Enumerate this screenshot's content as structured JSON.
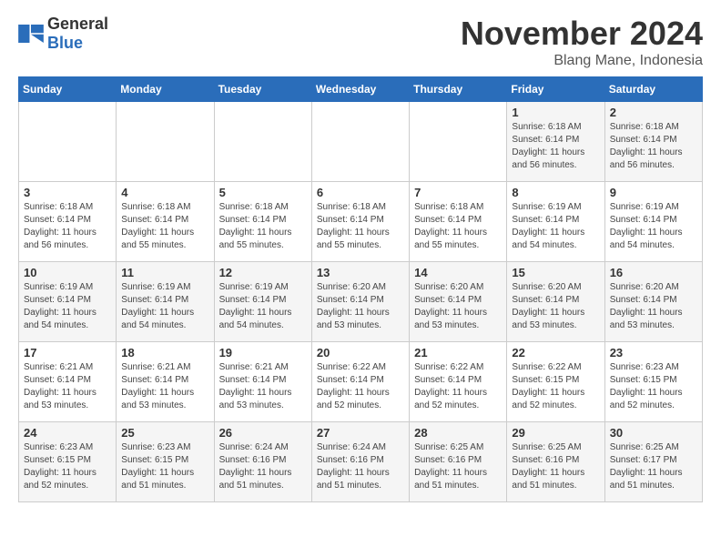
{
  "logo": {
    "text_general": "General",
    "text_blue": "Blue"
  },
  "title": "November 2024",
  "subtitle": "Blang Mane, Indonesia",
  "days_of_week": [
    "Sunday",
    "Monday",
    "Tuesday",
    "Wednesday",
    "Thursday",
    "Friday",
    "Saturday"
  ],
  "weeks": [
    [
      {
        "day": "",
        "info": ""
      },
      {
        "day": "",
        "info": ""
      },
      {
        "day": "",
        "info": ""
      },
      {
        "day": "",
        "info": ""
      },
      {
        "day": "",
        "info": ""
      },
      {
        "day": "1",
        "info": "Sunrise: 6:18 AM\nSunset: 6:14 PM\nDaylight: 11 hours\nand 56 minutes."
      },
      {
        "day": "2",
        "info": "Sunrise: 6:18 AM\nSunset: 6:14 PM\nDaylight: 11 hours\nand 56 minutes."
      }
    ],
    [
      {
        "day": "3",
        "info": "Sunrise: 6:18 AM\nSunset: 6:14 PM\nDaylight: 11 hours\nand 56 minutes."
      },
      {
        "day": "4",
        "info": "Sunrise: 6:18 AM\nSunset: 6:14 PM\nDaylight: 11 hours\nand 55 minutes."
      },
      {
        "day": "5",
        "info": "Sunrise: 6:18 AM\nSunset: 6:14 PM\nDaylight: 11 hours\nand 55 minutes."
      },
      {
        "day": "6",
        "info": "Sunrise: 6:18 AM\nSunset: 6:14 PM\nDaylight: 11 hours\nand 55 minutes."
      },
      {
        "day": "7",
        "info": "Sunrise: 6:18 AM\nSunset: 6:14 PM\nDaylight: 11 hours\nand 55 minutes."
      },
      {
        "day": "8",
        "info": "Sunrise: 6:19 AM\nSunset: 6:14 PM\nDaylight: 11 hours\nand 54 minutes."
      },
      {
        "day": "9",
        "info": "Sunrise: 6:19 AM\nSunset: 6:14 PM\nDaylight: 11 hours\nand 54 minutes."
      }
    ],
    [
      {
        "day": "10",
        "info": "Sunrise: 6:19 AM\nSunset: 6:14 PM\nDaylight: 11 hours\nand 54 minutes."
      },
      {
        "day": "11",
        "info": "Sunrise: 6:19 AM\nSunset: 6:14 PM\nDaylight: 11 hours\nand 54 minutes."
      },
      {
        "day": "12",
        "info": "Sunrise: 6:19 AM\nSunset: 6:14 PM\nDaylight: 11 hours\nand 54 minutes."
      },
      {
        "day": "13",
        "info": "Sunrise: 6:20 AM\nSunset: 6:14 PM\nDaylight: 11 hours\nand 53 minutes."
      },
      {
        "day": "14",
        "info": "Sunrise: 6:20 AM\nSunset: 6:14 PM\nDaylight: 11 hours\nand 53 minutes."
      },
      {
        "day": "15",
        "info": "Sunrise: 6:20 AM\nSunset: 6:14 PM\nDaylight: 11 hours\nand 53 minutes."
      },
      {
        "day": "16",
        "info": "Sunrise: 6:20 AM\nSunset: 6:14 PM\nDaylight: 11 hours\nand 53 minutes."
      }
    ],
    [
      {
        "day": "17",
        "info": "Sunrise: 6:21 AM\nSunset: 6:14 PM\nDaylight: 11 hours\nand 53 minutes."
      },
      {
        "day": "18",
        "info": "Sunrise: 6:21 AM\nSunset: 6:14 PM\nDaylight: 11 hours\nand 53 minutes."
      },
      {
        "day": "19",
        "info": "Sunrise: 6:21 AM\nSunset: 6:14 PM\nDaylight: 11 hours\nand 53 minutes."
      },
      {
        "day": "20",
        "info": "Sunrise: 6:22 AM\nSunset: 6:14 PM\nDaylight: 11 hours\nand 52 minutes."
      },
      {
        "day": "21",
        "info": "Sunrise: 6:22 AM\nSunset: 6:14 PM\nDaylight: 11 hours\nand 52 minutes."
      },
      {
        "day": "22",
        "info": "Sunrise: 6:22 AM\nSunset: 6:15 PM\nDaylight: 11 hours\nand 52 minutes."
      },
      {
        "day": "23",
        "info": "Sunrise: 6:23 AM\nSunset: 6:15 PM\nDaylight: 11 hours\nand 52 minutes."
      }
    ],
    [
      {
        "day": "24",
        "info": "Sunrise: 6:23 AM\nSunset: 6:15 PM\nDaylight: 11 hours\nand 52 minutes."
      },
      {
        "day": "25",
        "info": "Sunrise: 6:23 AM\nSunset: 6:15 PM\nDaylight: 11 hours\nand 51 minutes."
      },
      {
        "day": "26",
        "info": "Sunrise: 6:24 AM\nSunset: 6:16 PM\nDaylight: 11 hours\nand 51 minutes."
      },
      {
        "day": "27",
        "info": "Sunrise: 6:24 AM\nSunset: 6:16 PM\nDaylight: 11 hours\nand 51 minutes."
      },
      {
        "day": "28",
        "info": "Sunrise: 6:25 AM\nSunset: 6:16 PM\nDaylight: 11 hours\nand 51 minutes."
      },
      {
        "day": "29",
        "info": "Sunrise: 6:25 AM\nSunset: 6:16 PM\nDaylight: 11 hours\nand 51 minutes."
      },
      {
        "day": "30",
        "info": "Sunrise: 6:25 AM\nSunset: 6:17 PM\nDaylight: 11 hours\nand 51 minutes."
      }
    ]
  ]
}
